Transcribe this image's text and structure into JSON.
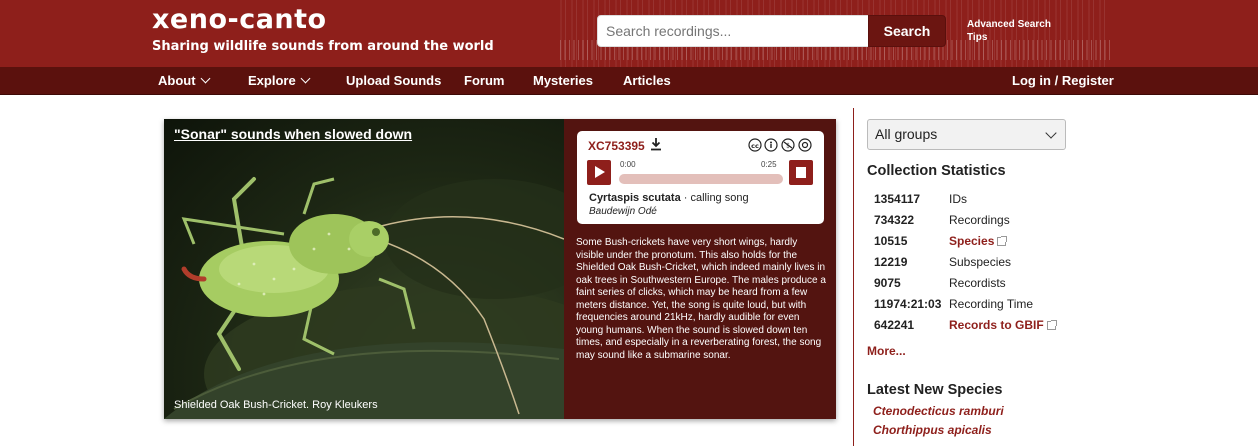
{
  "header": {
    "logo": "xeno-canto",
    "tagline": "Sharing wildlife sounds from around the world",
    "search_placeholder": "Search recordings...",
    "search_button": "Search",
    "advanced_search": "Advanced Search",
    "tips": "Tips",
    "brand_color": "#8e1f1b",
    "nav_color": "#5b110d"
  },
  "nav": {
    "about": "About",
    "explore": "Explore",
    "upload": "Upload Sounds",
    "forum": "Forum",
    "mysteries": "Mysteries",
    "articles": "Articles",
    "login": "Log in / Register"
  },
  "feature": {
    "title": "\"Sonar\" sounds when slowed down",
    "photo_caption": "Shielded Oak Bush-Cricket. Roy Kleukers",
    "player": {
      "id": "XC753395",
      "time_start": "0:00",
      "time_end": "0:25",
      "species": "Cyrtaspis scutata",
      "sound_type": " · calling song",
      "recordist": "Baudewijn Odé"
    },
    "description": "Some Bush-crickets have very short wings, hardly visible under the pronotum. This also holds for the Shielded Oak Bush-Cricket, which indeed mainly lives in oak trees in Southwestern Europe. The males produce a faint series of clicks, which may be heard from a few meters distance. Yet, the song is quite loud, but with frequencies around 21kHz, hardly audible for even young humans. When the sound is slowed down ten times, and especially in a reverberating forest, the song may sound like a submarine sonar."
  },
  "sidebar": {
    "group_select": "All groups",
    "stats_heading": "Collection Statistics",
    "stats": [
      {
        "value": "1354117",
        "label": "IDs"
      },
      {
        "value": "734322",
        "label": "Recordings"
      },
      {
        "value": "10515",
        "label": "Species"
      },
      {
        "value": "12219",
        "label": "Subspecies"
      },
      {
        "value": "9075",
        "label": "Recordists"
      },
      {
        "value": "11974:21:03",
        "label": "Recording Time"
      },
      {
        "value": "642241",
        "label": "Records to GBIF"
      }
    ],
    "more": "More...",
    "latest_heading": "Latest New Species",
    "latest": [
      "Ctenodecticus ramburi",
      "Chorthippus apicalis"
    ]
  }
}
